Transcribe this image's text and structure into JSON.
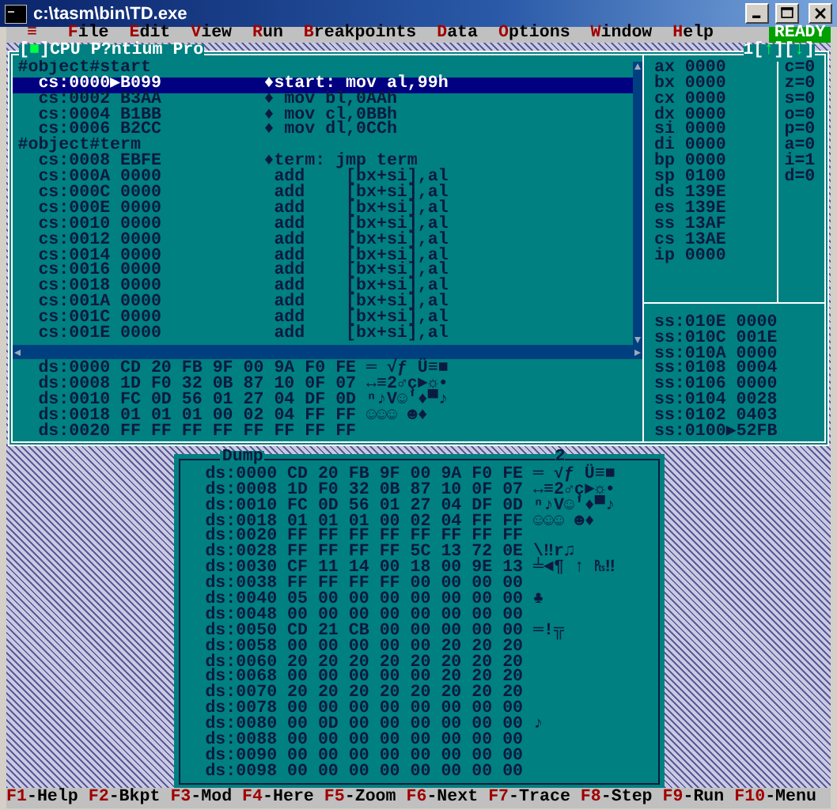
{
  "window": {
    "title": "c:\\tasm\\bin\\TD.exe"
  },
  "menu": {
    "system": "≡",
    "items": [
      {
        "label": "File"
      },
      {
        "label": "Edit"
      },
      {
        "label": "View"
      },
      {
        "label": "Run"
      },
      {
        "label": "Breakpoints"
      },
      {
        "label": "Data"
      },
      {
        "label": "Options"
      },
      {
        "label": "Window"
      },
      {
        "label": "Help"
      }
    ],
    "status": "READY"
  },
  "cpu": {
    "close": "[■]",
    "title": "CPU P?ntium Pro",
    "number": "1",
    "up": "[↑]",
    "down": "[↓]",
    "code": [
      {
        "kind": "label",
        "text": "#object#start",
        "selected": false
      },
      {
        "kind": "instr",
        "addr": "cs:0000▶B099",
        "asm": "♦start: mov al,99h",
        "selected": true
      },
      {
        "kind": "instr",
        "addr": "cs:0002 B3AA",
        "asm": "♦ mov bl,0AAh",
        "selected": false
      },
      {
        "kind": "instr",
        "addr": "cs:0004 B1BB",
        "asm": "♦ mov cl,0BBh",
        "selected": false
      },
      {
        "kind": "instr",
        "addr": "cs:0006 B2CC",
        "asm": "♦ mov dl,0CCh",
        "selected": false
      },
      {
        "kind": "label",
        "text": "#object#term",
        "selected": false
      },
      {
        "kind": "instr",
        "addr": "cs:0008 EBFE",
        "asm": "♦term: jmp term",
        "selected": false
      },
      {
        "kind": "op",
        "addr": "cs:000A 0000",
        "mnemonic": "add",
        "operands": "[bx+si],al",
        "selected": false
      },
      {
        "kind": "op",
        "addr": "cs:000C 0000",
        "mnemonic": "add",
        "operands": "[bx+si],al",
        "selected": false
      },
      {
        "kind": "op",
        "addr": "cs:000E 0000",
        "mnemonic": "add",
        "operands": "[bx+si],al",
        "selected": false
      },
      {
        "kind": "op",
        "addr": "cs:0010 0000",
        "mnemonic": "add",
        "operands": "[bx+si],al",
        "selected": false
      },
      {
        "kind": "op",
        "addr": "cs:0012 0000",
        "mnemonic": "add",
        "operands": "[bx+si],al",
        "selected": false
      },
      {
        "kind": "op",
        "addr": "cs:0014 0000",
        "mnemonic": "add",
        "operands": "[bx+si],al",
        "selected": false
      },
      {
        "kind": "op",
        "addr": "cs:0016 0000",
        "mnemonic": "add",
        "operands": "[bx+si],al",
        "selected": false
      },
      {
        "kind": "op",
        "addr": "cs:0018 0000",
        "mnemonic": "add",
        "operands": "[bx+si],al",
        "selected": false
      },
      {
        "kind": "op",
        "addr": "cs:001A 0000",
        "mnemonic": "add",
        "operands": "[bx+si],al",
        "selected": false
      },
      {
        "kind": "op",
        "addr": "cs:001C 0000",
        "mnemonic": "add",
        "operands": "[bx+si],al",
        "selected": false
      },
      {
        "kind": "op",
        "addr": "cs:001E 0000",
        "mnemonic": "add",
        "operands": "[bx+si],al",
        "selected": false
      }
    ],
    "data": [
      {
        "addr": "ds:0000",
        "bytes": "CD 20 FB 9F 00 9A F0 FE",
        "ascii": "═ √ƒ Ü≡■"
      },
      {
        "addr": "ds:0008",
        "bytes": "1D F0 32 0B 87 10 0F 07",
        "ascii": "↔≡2♂ç►☼•"
      },
      {
        "addr": "ds:0010",
        "bytes": "FC 0D 56 01 27 04 DF 0D",
        "ascii": "ⁿ♪V☺'♦▀♪"
      },
      {
        "addr": "ds:0018",
        "bytes": "01 01 01 00 02 04 FF FF",
        "ascii": "☺☺☺ ☻♦"
      },
      {
        "addr": "ds:0020",
        "bytes": "FF FF FF FF FF FF FF FF"
      }
    ],
    "registers": [
      {
        "name": "ax",
        "value": "0000"
      },
      {
        "name": "bx",
        "value": "0000"
      },
      {
        "name": "cx",
        "value": "0000"
      },
      {
        "name": "dx",
        "value": "0000"
      },
      {
        "name": "si",
        "value": "0000"
      },
      {
        "name": "di",
        "value": "0000"
      },
      {
        "name": "bp",
        "value": "0000"
      },
      {
        "name": "sp",
        "value": "0100"
      },
      {
        "name": "ds",
        "value": "139E"
      },
      {
        "name": "es",
        "value": "139E"
      },
      {
        "name": "ss",
        "value": "13AF"
      },
      {
        "name": "cs",
        "value": "13AE"
      },
      {
        "name": "ip",
        "value": "0000"
      }
    ],
    "flag_separator": "=",
    "flags": [
      {
        "name": "c",
        "value": "0"
      },
      {
        "name": "z",
        "value": "0"
      },
      {
        "name": "s",
        "value": "0"
      },
      {
        "name": "o",
        "value": "0"
      },
      {
        "name": "p",
        "value": "0"
      },
      {
        "name": "a",
        "value": "0"
      },
      {
        "name": "i",
        "value": "1"
      },
      {
        "name": "d",
        "value": "0"
      }
    ],
    "stack": [
      "ss:010E 0000",
      "ss:010C 001E",
      "ss:010A 0000",
      "ss:0108 0004",
      "ss:0106 0000",
      "ss:0104 0028",
      "ss:0102 0403",
      "ss:0100▶52FB"
    ]
  },
  "dump": {
    "title": "Dump",
    "number": "2",
    "rows": [
      {
        "addr": "ds:0000",
        "bytes": "CD 20 FB 9F 00 9A F0 FE",
        "ascii": "═ √ƒ Ü≡■"
      },
      {
        "addr": "ds:0008",
        "bytes": "1D F0 32 0B 87 10 0F 07",
        "ascii": "↔≡2♂ç►☼•"
      },
      {
        "addr": "ds:0010",
        "bytes": "FC 0D 56 01 27 04 DF 0D",
        "ascii": "ⁿ♪V☺'♦▀♪"
      },
      {
        "addr": "ds:0018",
        "bytes": "01 01 01 00 02 04 FF FF",
        "ascii": "☺☺☺ ☻♦"
      },
      {
        "addr": "ds:0020",
        "bytes": "FF FF FF FF FF FF FF FF"
      },
      {
        "addr": "ds:0028",
        "bytes": "FF FF FF FF 5C 13 72 0E",
        "ascii": "\\‼r♫"
      },
      {
        "addr": "ds:0030",
        "bytes": "CF 11 14 00 18 00 9E 13",
        "ascii": "╧◄¶ ↑ ₧‼"
      },
      {
        "addr": "ds:0038",
        "bytes": "FF FF FF FF 00 00 00 00"
      },
      {
        "addr": "ds:0040",
        "bytes": "05 00 00 00 00 00 00 00",
        "ascii": "♣"
      },
      {
        "addr": "ds:0048",
        "bytes": "00 00 00 00 00 00 00 00"
      },
      {
        "addr": "ds:0050",
        "bytes": "CD 21 CB 00 00 00 00 00",
        "ascii": "═!╦"
      },
      {
        "addr": "ds:0058",
        "bytes": "00 00 00 00 00 20 20 20"
      },
      {
        "addr": "ds:0060",
        "bytes": "20 20 20 20 20 20 20 20"
      },
      {
        "addr": "ds:0068",
        "bytes": "00 00 00 00 00 20 20 20"
      },
      {
        "addr": "ds:0070",
        "bytes": "20 20 20 20 20 20 20 20"
      },
      {
        "addr": "ds:0078",
        "bytes": "00 00 00 00 00 00 00 00"
      },
      {
        "addr": "ds:0080",
        "bytes": "00 0D 00 00 00 00 00 00",
        "ascii": "♪"
      },
      {
        "addr": "ds:0088",
        "bytes": "00 00 00 00 00 00 00 00"
      },
      {
        "addr": "ds:0090",
        "bytes": "00 00 00 00 00 00 00 00"
      },
      {
        "addr": "ds:0098",
        "bytes": "00 00 00 00 00 00 00 00"
      }
    ]
  },
  "function_keys": [
    {
      "key": "F1",
      "action": "-Help"
    },
    {
      "key": "F2",
      "action": "-Bkpt"
    },
    {
      "key": "F3",
      "action": "-Mod"
    },
    {
      "key": "F4",
      "action": "-Here"
    },
    {
      "key": "F5",
      "action": "-Zoom"
    },
    {
      "key": "F6",
      "action": "-Next"
    },
    {
      "key": "F7",
      "action": "-Trace"
    },
    {
      "key": "F8",
      "action": "-Step"
    },
    {
      "key": "F9",
      "action": "-Run"
    },
    {
      "key": "F10",
      "action": "-Menu"
    }
  ]
}
